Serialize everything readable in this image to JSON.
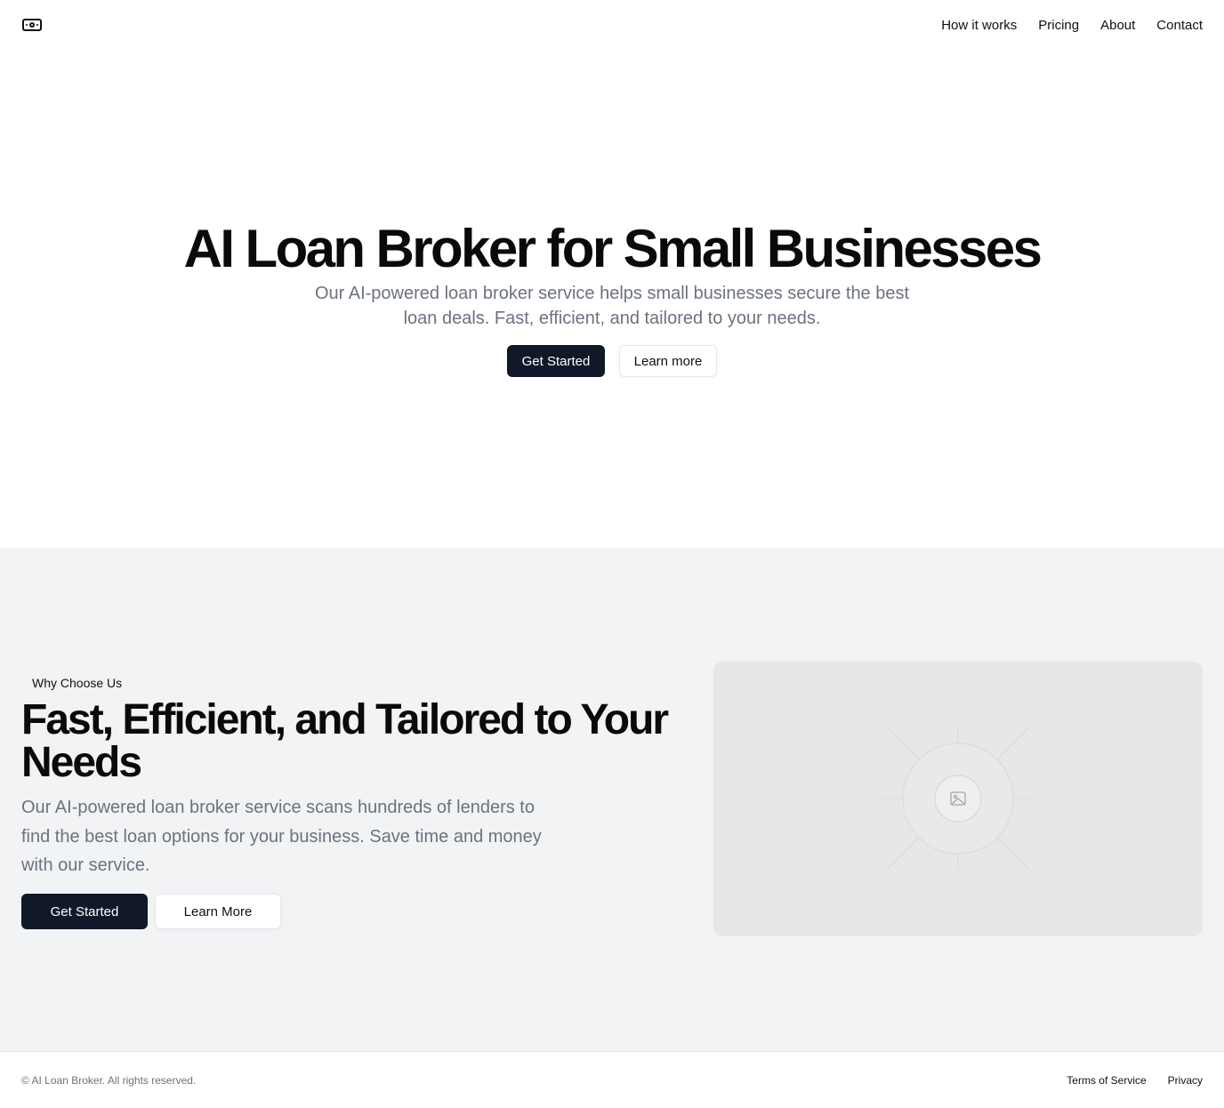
{
  "header": {
    "logo_icon": "banknote-icon",
    "nav": [
      {
        "label": "How it works"
      },
      {
        "label": "Pricing"
      },
      {
        "label": "About"
      },
      {
        "label": "Contact"
      }
    ]
  },
  "hero": {
    "title": "AI Loan Broker for Small Businesses",
    "subtitle": "Our AI-powered loan broker service helps small businesses secure the best loan deals. Fast, efficient, and tailored to your needs.",
    "primary_button": "Get Started",
    "secondary_button": "Learn more"
  },
  "features": {
    "badge": "Why Choose Us",
    "title": "Fast, Efficient, and Tailored to Your Needs",
    "subtitle": "Our AI-powered loan broker service scans hundreds of lenders to find the best loan options for your business. Save time and money with our service.",
    "primary_button": "Get Started",
    "secondary_button": "Learn More",
    "image_icon": "image-placeholder-icon"
  },
  "footer": {
    "copyright": "© AI Loan Broker. All rights reserved.",
    "links": [
      {
        "label": "Terms of Service"
      },
      {
        "label": "Privacy"
      }
    ]
  },
  "colors": {
    "primary": "#111827",
    "muted_text": "#6b7280",
    "section_bg": "#f2f3f5",
    "placeholder_bg": "#e7e7e8"
  }
}
